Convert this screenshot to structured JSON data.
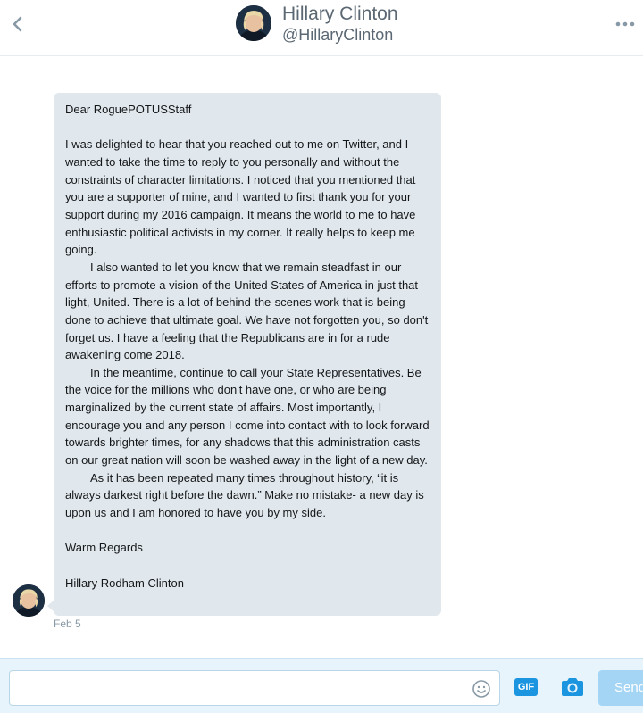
{
  "header": {
    "name": "Hillary Clinton",
    "handle": "@HillaryClinton",
    "back_icon": "chevron-left-icon",
    "more_icon": "more-dots-icon"
  },
  "message": {
    "salutation": "Dear RoguePOTUSStaff",
    "paragraph_1": "I was delighted to hear that you reached out to me on Twitter, and I wanted to take the time to reply to you personally and without the constraints of character limitations. I noticed that you mentioned that you are a supporter of mine, and I wanted to first thank you for your support during my 2016 campaign. It means the world to me to have enthusiastic political activists in my corner. It really helps to keep me going.",
    "paragraph_2": "I also wanted to let you know that we remain steadfast in our efforts to promote a vision of the United States of America in just that light, United. There is a lot of behind-the-scenes work that is being done to achieve that ultimate goal. We have not forgotten you, so don't forget us. I have a feeling that the Republicans are in for a rude awakening come 2018.",
    "paragraph_3": "In the meantime, continue to call your State Representatives. Be the voice for the millions who don't have one, or who are being marginalized by the current state of affairs. Most importantly, I encourage you and any person I come into contact with to look forward towards brighter times, for any shadows that this administration casts on our great nation will soon be washed away in the light of a new day.",
    "paragraph_4": "As it has been repeated many times throughout history, “it is always darkest right before the dawn.” Make no mistake- a new day is upon us and I am honored to have you by my side.",
    "closing": "Warm Regards",
    "signature": "Hillary Rodham Clinton",
    "timestamp": "Feb 5"
  },
  "composer": {
    "input_value": "",
    "input_placeholder": "",
    "emoji_icon": "smiley-icon",
    "gif_label": "GIF",
    "camera_icon": "camera-icon",
    "send_label": "Send"
  },
  "colors": {
    "bubble_bg": "#e1e8ed",
    "accent": "#1b95e0",
    "composer_bg": "#e8f4fb",
    "send_disabled": "#a5d5f5"
  }
}
